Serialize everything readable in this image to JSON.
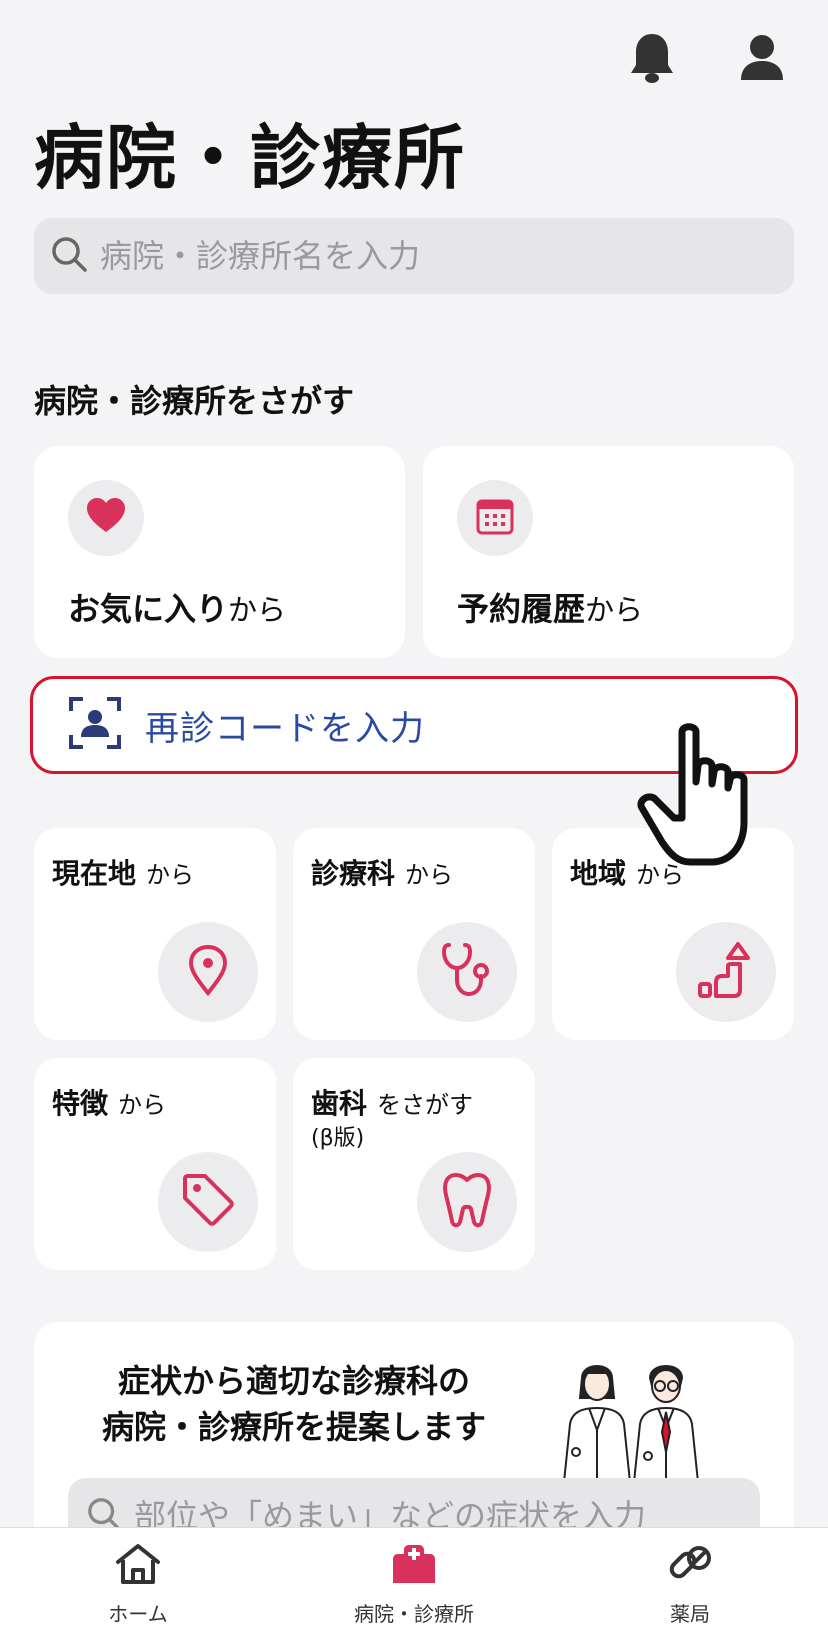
{
  "header": {
    "title": "病院・診療所",
    "bell_icon": "bell-icon",
    "user_icon": "user-icon"
  },
  "search": {
    "placeholder": "病院・診療所名を入力"
  },
  "section": {
    "title": "病院・診療所をさがす"
  },
  "quick_cards": [
    {
      "main": "お気に入り",
      "suffix": "から",
      "icon": "heart-icon"
    },
    {
      "main": "予約履歴",
      "suffix": "から",
      "icon": "calendar-icon"
    }
  ],
  "revisit": {
    "label": "再診コードを入力",
    "icon": "face-scan-icon"
  },
  "grid_cards": [
    {
      "main": "現在地",
      "suffix": "から",
      "sub": "",
      "icon": "location-pin-icon"
    },
    {
      "main": "診療科",
      "suffix": "から",
      "sub": "",
      "icon": "stethoscope-icon"
    },
    {
      "main": "地域",
      "suffix": "から",
      "sub": "",
      "icon": "region-blocks-icon"
    },
    {
      "main": "特徴",
      "suffix": "から",
      "sub": "",
      "icon": "tag-icon"
    },
    {
      "main": "歯科",
      "suffix": "をさがす",
      "sub": "(β版)",
      "icon": "tooth-icon"
    }
  ],
  "promo": {
    "line1": "症状から適切な診療科の",
    "line2": "病院・診療所を提案します",
    "search_placeholder": "部位や「めまい」などの症状を入力"
  },
  "bottom_nav": [
    {
      "label": "ホーム",
      "icon": "home-icon",
      "active": false
    },
    {
      "label": "病院・診療所",
      "icon": "hospital-icon",
      "active": true
    },
    {
      "label": "薬局",
      "icon": "pill-icon",
      "active": false
    }
  ],
  "colors": {
    "accent": "#d7142a",
    "pink_icon": "#d8315b",
    "link_blue": "#2a4aa1",
    "background": "#f4f4f6"
  }
}
